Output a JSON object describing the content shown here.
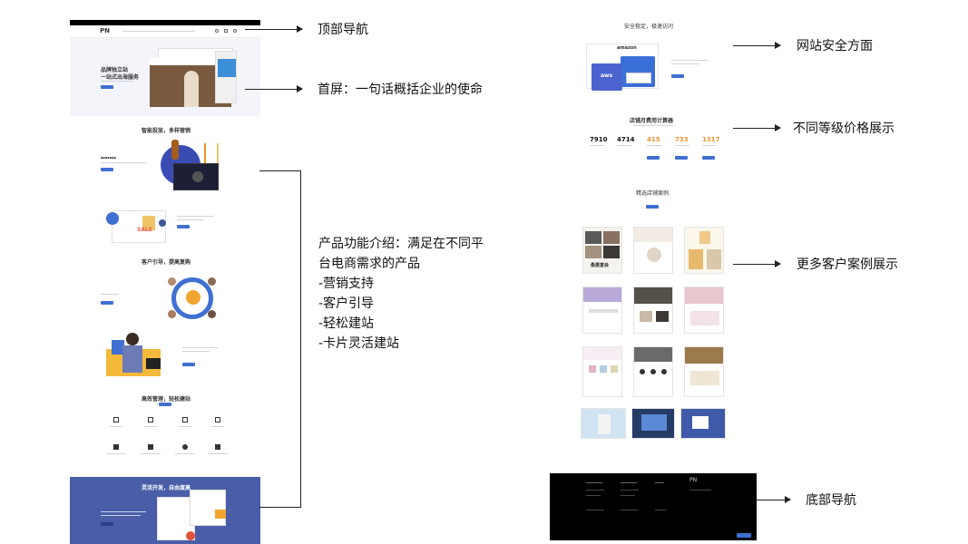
{
  "labels": {
    "top_nav": "顶部导航",
    "hero": "首屏：一句话概括企业的使命",
    "product_intro_lines": [
      "产品功能介绍：满足在不同平",
      "台电商需求的产品",
      "-营销支持",
      "-客户引导",
      "-轻松建站",
      "-卡片灵活建站"
    ],
    "security": "网站安全方面",
    "pricing": "不同等级价格展示",
    "cases": "更多客户案例展示",
    "footer": "底部导航"
  },
  "left_page": {
    "logo": "PN",
    "hero_title": "品牌独立站",
    "hero_subtitle": "一站式出海服务",
    "section1_title": "智能投放，多样营销",
    "section2_title": "客户引导，提高复购",
    "section3_title": "高效管理，轻松建站",
    "section4_title": "灵活开发，自由度高",
    "sale_badge": "SALE"
  },
  "right_page": {
    "security_title": "安全稳定，极速访问",
    "amazon_text": "amazon",
    "aws_text": "aws",
    "pricing_title": "店铺月费用计算器",
    "prices": [
      "7910",
      "4714",
      "415",
      "733",
      "1317"
    ],
    "cases_title": "精选店铺案例",
    "case_store_name": "桑惠宴会",
    "footer_logo": "PN"
  },
  "colors": {
    "accent_blue": "#3f6fd1",
    "banner_blue": "#4a5ea8",
    "footer_black": "#000000",
    "orange": "#f0932b"
  }
}
